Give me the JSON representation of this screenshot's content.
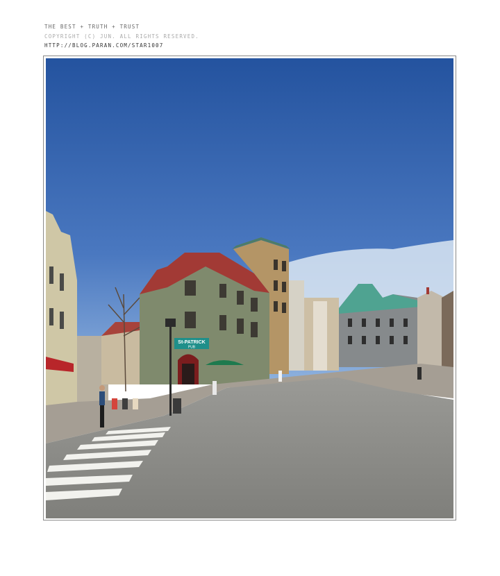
{
  "header": {
    "line1": "THE BEST + TRUTH + TRUST",
    "line2": "COPYRIGHT (C) JUN. ALL RIGHTS RESERVED.",
    "line3": "HTTP://BLOG.PARAN.COM/STAR1007"
  },
  "photo": {
    "sign_text": "St-PATRICK",
    "sign_sub": "PUB"
  },
  "colors": {
    "sky_top": "#2f5fae",
    "sky_bottom": "#7fa5d8",
    "road": "#8c8c88",
    "roof_red": "#a23a35",
    "roof_green": "#4fa391"
  }
}
